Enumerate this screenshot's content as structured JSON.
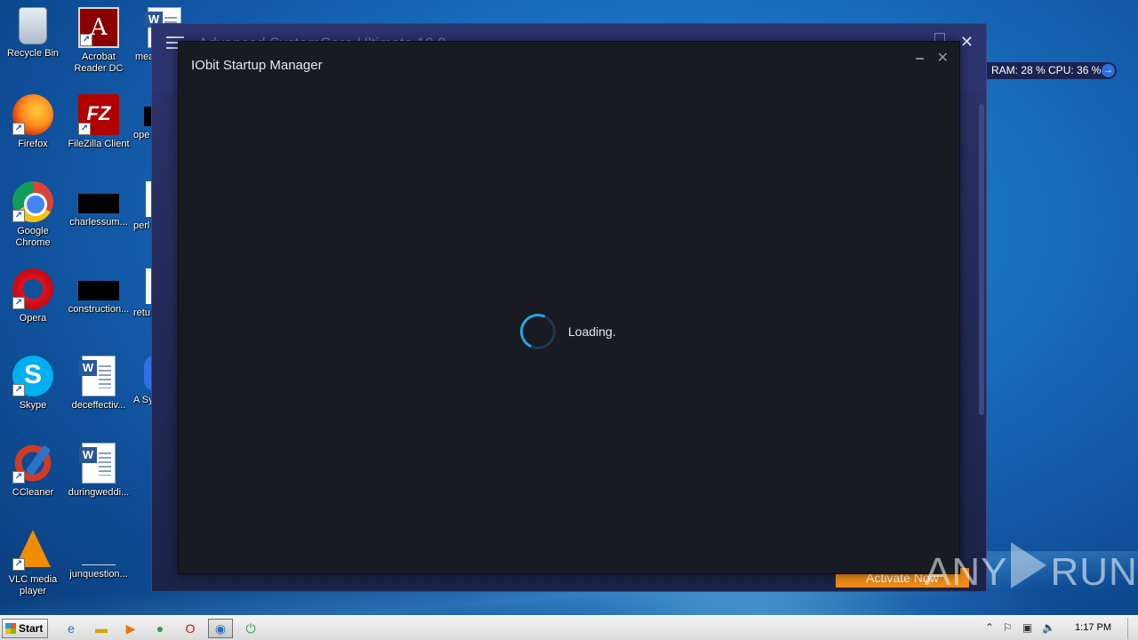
{
  "desktop": {
    "icons": [
      {
        "label": "Recycle Bin"
      },
      {
        "label": "Acrobat Reader DC"
      },
      {
        "label": "mea"
      },
      {
        "label": "Firefox"
      },
      {
        "label": "FileZilla Client"
      },
      {
        "label": "ope"
      },
      {
        "label": "Google Chrome"
      },
      {
        "label": "charlessum..."
      },
      {
        "label": "perl"
      },
      {
        "label": "Opera"
      },
      {
        "label": "construction..."
      },
      {
        "label": "retu"
      },
      {
        "label": "Skype"
      },
      {
        "label": "deceffectiv..."
      },
      {
        "label": "A Sy"
      },
      {
        "label": "CCleaner"
      },
      {
        "label": "duringweddi..."
      },
      {
        "label": "VLC media player"
      },
      {
        "label": "junquestion..."
      }
    ]
  },
  "background_app": {
    "title": "Advanced SystemCare Ultimate 10.0",
    "activate_label": "Activate Now"
  },
  "system_widget": {
    "text": "RAM: 28 %  CPU: 36 %",
    "arrow": "→"
  },
  "modal": {
    "title": "IObit Startup Manager",
    "minimize": "–",
    "close": "✕",
    "loading_text": "Loading."
  },
  "watermark": {
    "left": "ANY",
    "right": "RUN"
  },
  "taskbar": {
    "start_label": "Start",
    "clock": "1:17 PM"
  },
  "colors": {
    "modal_bg": "#181b22",
    "spinner": "#2aa4e6",
    "activate": "#f08c16"
  }
}
